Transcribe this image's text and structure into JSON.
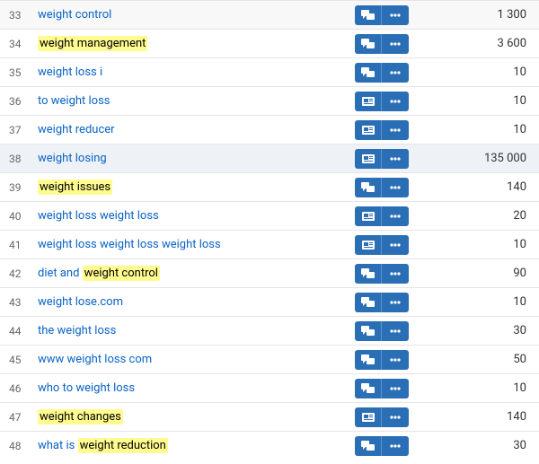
{
  "icons": {
    "chat": "chat-icon",
    "card": "card-icon",
    "dots": "dots-icon"
  },
  "rows": [
    {
      "num": "33",
      "keyword": "weight control",
      "hl": null,
      "icon": "chat",
      "value": "1 300",
      "sel": false
    },
    {
      "num": "34",
      "keyword": "weight management",
      "hl": "weight management",
      "icon": "chat",
      "value": "3 600",
      "sel": false
    },
    {
      "num": "35",
      "keyword": "weight loss i",
      "hl": null,
      "icon": "chat",
      "value": "10",
      "sel": false
    },
    {
      "num": "36",
      "keyword": "to weight loss",
      "hl": null,
      "icon": "card",
      "value": "10",
      "sel": false
    },
    {
      "num": "37",
      "keyword": "weight reducer",
      "hl": null,
      "icon": "card",
      "value": "10",
      "sel": false
    },
    {
      "num": "38",
      "keyword": "weight losing",
      "hl": null,
      "icon": "card",
      "value": "135 000",
      "sel": true
    },
    {
      "num": "39",
      "keyword": "weight issues",
      "hl": "weight issues",
      "icon": "chat",
      "value": "140",
      "sel": false
    },
    {
      "num": "40",
      "keyword": "weight loss weight loss",
      "hl": null,
      "icon": "card",
      "value": "20",
      "sel": false
    },
    {
      "num": "41",
      "keyword": "weight loss weight loss weight loss",
      "hl": null,
      "icon": "card",
      "value": "10",
      "sel": false
    },
    {
      "num": "42",
      "keyword": "diet and weight control",
      "hl": "weight control",
      "icon": "chat",
      "value": "90",
      "sel": false
    },
    {
      "num": "43",
      "keyword": "weight lose.com",
      "hl": null,
      "icon": "chat",
      "value": "10",
      "sel": false
    },
    {
      "num": "44",
      "keyword": "the weight loss",
      "hl": null,
      "icon": "chat",
      "value": "30",
      "sel": false
    },
    {
      "num": "45",
      "keyword": "www weight loss com",
      "hl": null,
      "icon": "chat",
      "value": "50",
      "sel": false
    },
    {
      "num": "46",
      "keyword": "who to weight loss",
      "hl": null,
      "icon": "chat",
      "value": "10",
      "sel": false
    },
    {
      "num": "47",
      "keyword": "weight changes",
      "hl": "weight changes",
      "icon": "card",
      "value": "140",
      "sel": false
    },
    {
      "num": "48",
      "keyword": "what is weight reduction",
      "hl": "weight reduction",
      "icon": "chat",
      "value": "30",
      "sel": false
    }
  ]
}
